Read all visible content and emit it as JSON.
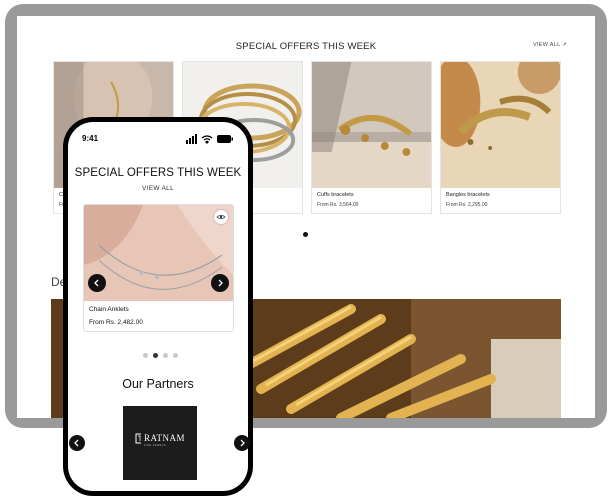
{
  "desktop": {
    "heading": "SPECIAL OFFERS THIS WEEK",
    "view_all": "VIEW ALL ↗",
    "cards": [
      {
        "name": "Cl",
        "price": "Fr"
      },
      {
        "name": "",
        "price": ""
      },
      {
        "name": "Cuffs bracelets",
        "price": "From Rs. 3,564.00"
      },
      {
        "name": "Bangles bracelets",
        "price": "From Rs. 2,295.00"
      }
    ],
    "section2_partial": "De"
  },
  "phone": {
    "time": "9:41",
    "heading": "SPECIAL OFFERS THIS WEEK",
    "view_all": "VIEW ALL",
    "card": {
      "name": "Chain Anklets",
      "price": "From Rs. 2,482.00"
    },
    "carousel": {
      "total": 4,
      "active": 2
    },
    "partners_heading": "Our Partners",
    "partner": {
      "name": "RATNAM",
      "tagline": "FINE JEWELS"
    }
  },
  "icons": [
    "eye-icon",
    "chevron-left-icon",
    "chevron-right-icon",
    "signal-icon",
    "wifi-icon",
    "battery-icon",
    "external-link-icon"
  ]
}
